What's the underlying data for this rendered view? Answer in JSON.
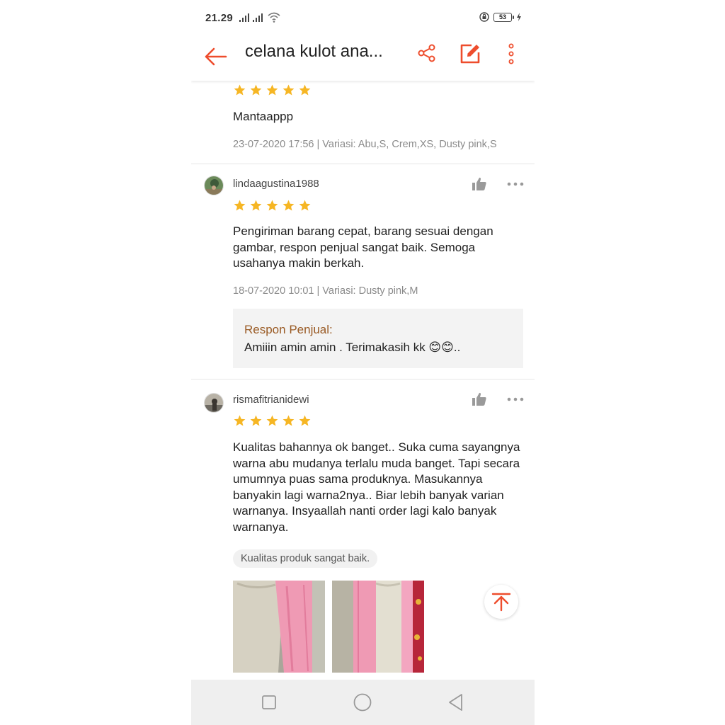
{
  "status_bar": {
    "time": "21.29",
    "battery": "53"
  },
  "app_bar": {
    "title": "celana kulot ana..."
  },
  "colors": {
    "accent": "#ee4d2d",
    "star": "#f6b624",
    "seller_label": "#9a5b25",
    "meta_text": "#8a8a8a"
  },
  "reviews": [
    {
      "rating": 5,
      "text": "Mantaappp",
      "meta": "23-07-2020 17:56 | Variasi: Abu,S, Crem,XS, Dusty pink,S"
    },
    {
      "username": "lindaagustina1988",
      "rating": 5,
      "text": "Pengiriman barang cepat, barang sesuai dengan gambar, respon penjual sangat baik. Semoga usahanya makin berkah.",
      "meta": "18-07-2020 10:01 | Variasi: Dusty pink,M",
      "seller_response": {
        "label": "Respon Penjual:",
        "text": "Amiiin amin amin   . Terimakasih kk 😊😊.."
      }
    },
    {
      "username": "rismafitrianidewi",
      "rating": 5,
      "text": "Kualitas bahannya ok banget.. Suka cuma sayangnya warna abu mudanya terlalu muda banget. Tapi secara umumnya puas sama produknya. Masukannya banyakin lagi warna2nya.. Biar lebih banyak varian warnanya. Insyaallah nanti order lagi kalo banyak warnanya.",
      "tag": "Kualitas produk sangat baik."
    }
  ],
  "icons": {
    "back": "arrow-left-icon",
    "share": "share-icon",
    "edit": "edit-icon",
    "more": "more-vertical-icon",
    "like": "thumbs-up-icon",
    "options": "more-horizontal-icon",
    "scroll_top": "arrow-up-to-top-icon"
  }
}
